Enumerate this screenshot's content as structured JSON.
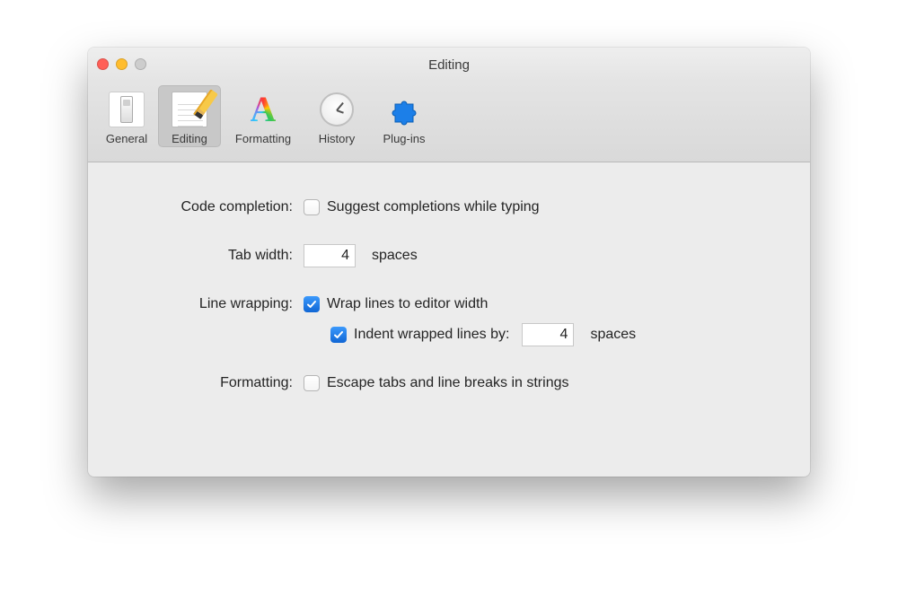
{
  "window": {
    "title": "Editing"
  },
  "toolbar": {
    "items": [
      {
        "label": "General"
      },
      {
        "label": "Editing"
      },
      {
        "label": "Formatting"
      },
      {
        "label": "History"
      },
      {
        "label": "Plug-ins"
      }
    ],
    "selected_index": 1
  },
  "settings": {
    "code_completion": {
      "label": "Code completion:",
      "suggest_label": "Suggest completions while typing",
      "suggest_checked": false
    },
    "tab_width": {
      "label": "Tab width:",
      "value": "4",
      "unit": "spaces"
    },
    "line_wrapping": {
      "label": "Line wrapping:",
      "wrap_label": "Wrap lines to editor width",
      "wrap_checked": true,
      "indent_label": "Indent wrapped lines by:",
      "indent_checked": true,
      "indent_value": "4",
      "indent_unit": "spaces"
    },
    "formatting": {
      "label": "Formatting:",
      "escape_label": "Escape tabs and line breaks in strings",
      "escape_checked": false
    }
  }
}
